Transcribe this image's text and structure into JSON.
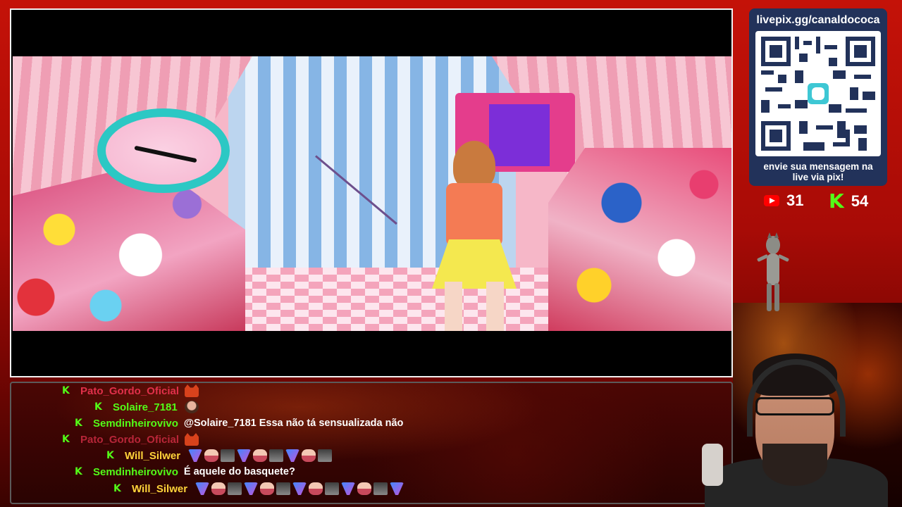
{
  "overlay": {
    "qr_url": "livepix.gg/canaldococa",
    "qr_caption": "envie sua mensagem na live via pix!",
    "youtube_count": "31",
    "kick_count": "54",
    "kick_symbol": "K"
  },
  "chat": {
    "messages": [
      {
        "user": "Pato_Gordo_Oficial",
        "text": "",
        "user_color": "#e0304a",
        "emotes": [
          "cat"
        ]
      },
      {
        "user": "Solaire_7181",
        "text": "",
        "user_color": "#53fc18",
        "emotes": [
          "face"
        ]
      },
      {
        "user": "Semdinheirovivo",
        "text": "@Solaire_7181 Essa não tá sensualizada não",
        "user_color": "#53fc18",
        "emotes": []
      },
      {
        "user": "Pato_Gordo_Oficial",
        "text": "",
        "user_color": "#e0304a",
        "emotes": [
          "cat"
        ]
      },
      {
        "user": "Will_Silwer",
        "text": "",
        "user_color": "#ffd43a",
        "emotes": [
          "hx",
          "girl",
          "zm",
          "hx",
          "girl",
          "zm",
          "hx",
          "girl",
          "zm"
        ]
      },
      {
        "user": "Semdinheirovivo",
        "text": "É aquele do basquete?",
        "user_color": "#53fc18",
        "emotes": []
      },
      {
        "user": "Will_Silwer",
        "text": "",
        "user_color": "#ffd43a",
        "emotes": [
          "hx",
          "girl",
          "zm",
          "hx",
          "girl",
          "zm",
          "hx",
          "girl",
          "zm",
          "hx",
          "girl",
          "zm",
          "hx"
        ]
      }
    ]
  },
  "colors": {
    "kick_green": "#53fc18",
    "youtube_red": "#ff0000",
    "qr_panel": "#22325a"
  }
}
